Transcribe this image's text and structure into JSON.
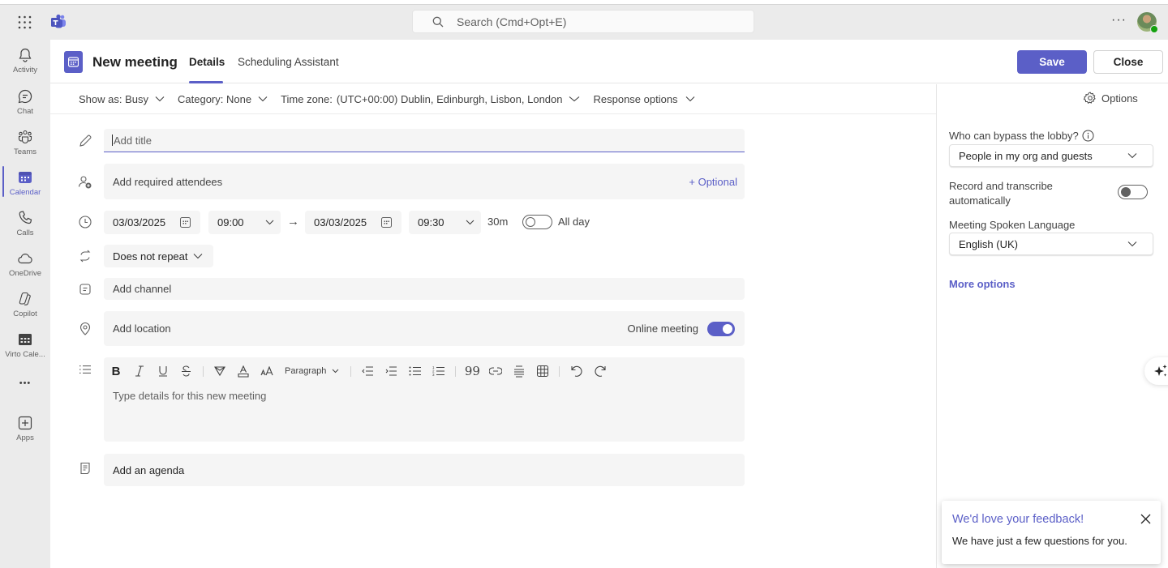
{
  "app": {
    "search_placeholder": "Search (Cmd+Opt+E)",
    "more_label": "···"
  },
  "rail": {
    "items": [
      {
        "label": "Activity",
        "icon": "bell-icon",
        "active": false
      },
      {
        "label": "Chat",
        "icon": "chat-icon",
        "active": false
      },
      {
        "label": "Teams",
        "icon": "teams-icon",
        "active": false
      },
      {
        "label": "Calendar",
        "icon": "calendar-icon",
        "active": true
      },
      {
        "label": "Calls",
        "icon": "phone-icon",
        "active": false
      },
      {
        "label": "OneDrive",
        "icon": "cloud-icon",
        "active": false
      },
      {
        "label": "Copilot",
        "icon": "copilot-icon",
        "active": false
      },
      {
        "label": "Virto Cale...",
        "icon": "virto-calendar-icon",
        "active": false
      },
      {
        "label": "",
        "icon": "more-icon",
        "active": false
      },
      {
        "label": "Apps",
        "icon": "add-apps-icon",
        "active": false
      }
    ],
    "more_glyph": "•••"
  },
  "header": {
    "title": "New meeting",
    "tabs": [
      {
        "label": "Details",
        "active": true
      },
      {
        "label": "Scheduling Assistant",
        "active": false
      }
    ],
    "save_label": "Save",
    "close_label": "Close"
  },
  "options_bar": {
    "show_as": "Show as: Busy",
    "category": "Category: None",
    "time_zone_label": "Time zone:",
    "time_zone_value": "(UTC+00:00) Dublin, Edinburgh, Lisbon, London",
    "response_options": "Response options"
  },
  "form": {
    "title_placeholder": "Add title",
    "attendees_placeholder": "Add required attendees",
    "optional_label": "+ Optional",
    "start_date": "03/03/2025",
    "start_time": "09:00",
    "end_date": "03/03/2025",
    "end_time": "09:30",
    "arrow": "→",
    "duration": "30m",
    "all_day_label": "All day",
    "all_day_on": false,
    "repeat": "Does not repeat",
    "channel_placeholder": "Add channel",
    "location_placeholder": "Add location",
    "online_meeting_label": "Online meeting",
    "online_meeting_on": true,
    "editor": {
      "paragraph_label": "Paragraph",
      "placeholder": "Type details for this new meeting"
    },
    "agenda_placeholder": "Add an agenda"
  },
  "right_panel": {
    "options_label": "Options",
    "lobby_label": "Who can bypass the lobby?",
    "lobby_value": "People in my org and guests",
    "record_label_line1": "Record and transcribe",
    "record_label_line2": "automatically",
    "record_on": false,
    "language_label": "Meeting Spoken Language",
    "language_value": "English (UK)",
    "more_options": "More options"
  },
  "feedback": {
    "title": "We'd love your feedback!",
    "body": "We have just a few questions for you."
  },
  "colors": {
    "accent": "#5b5fc7",
    "rail_bg": "#ebebeb",
    "field_bg": "#f5f5f5",
    "presence": "#13a10e"
  }
}
